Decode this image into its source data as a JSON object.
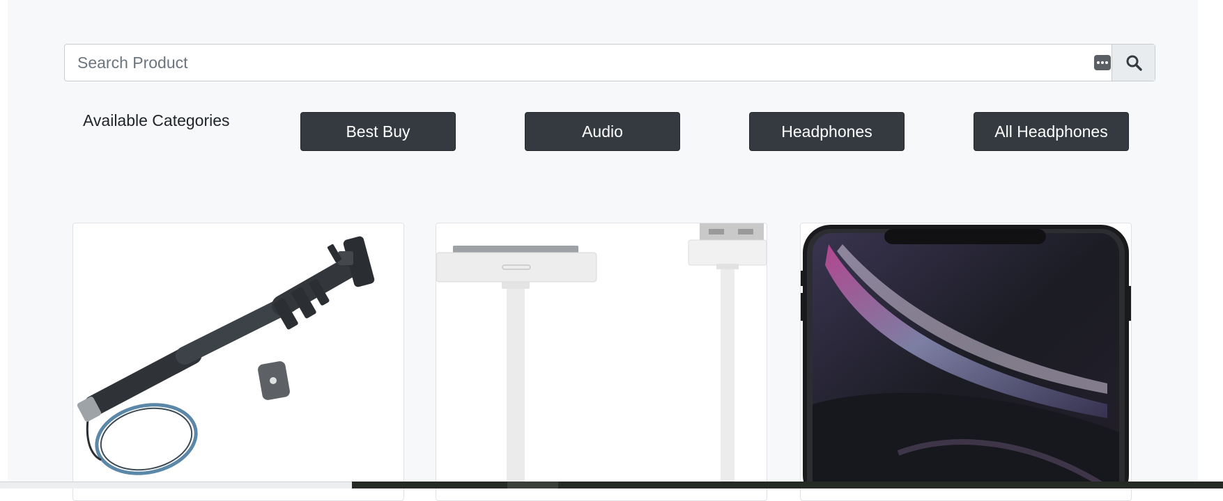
{
  "search": {
    "placeholder": "Search Product",
    "value": ""
  },
  "categories": {
    "label": "Available Categories",
    "items": [
      "Best Buy",
      "Audio",
      "Headphones",
      "All Headphones"
    ]
  },
  "products": [
    {
      "image": "monopod-selfie-stick"
    },
    {
      "image": "usb-30-pin-cable"
    },
    {
      "image": "iphone-xr-black"
    }
  ],
  "colors": {
    "background": "#f7f8fa",
    "button": "#343a40",
    "button_text": "#ffffff"
  }
}
